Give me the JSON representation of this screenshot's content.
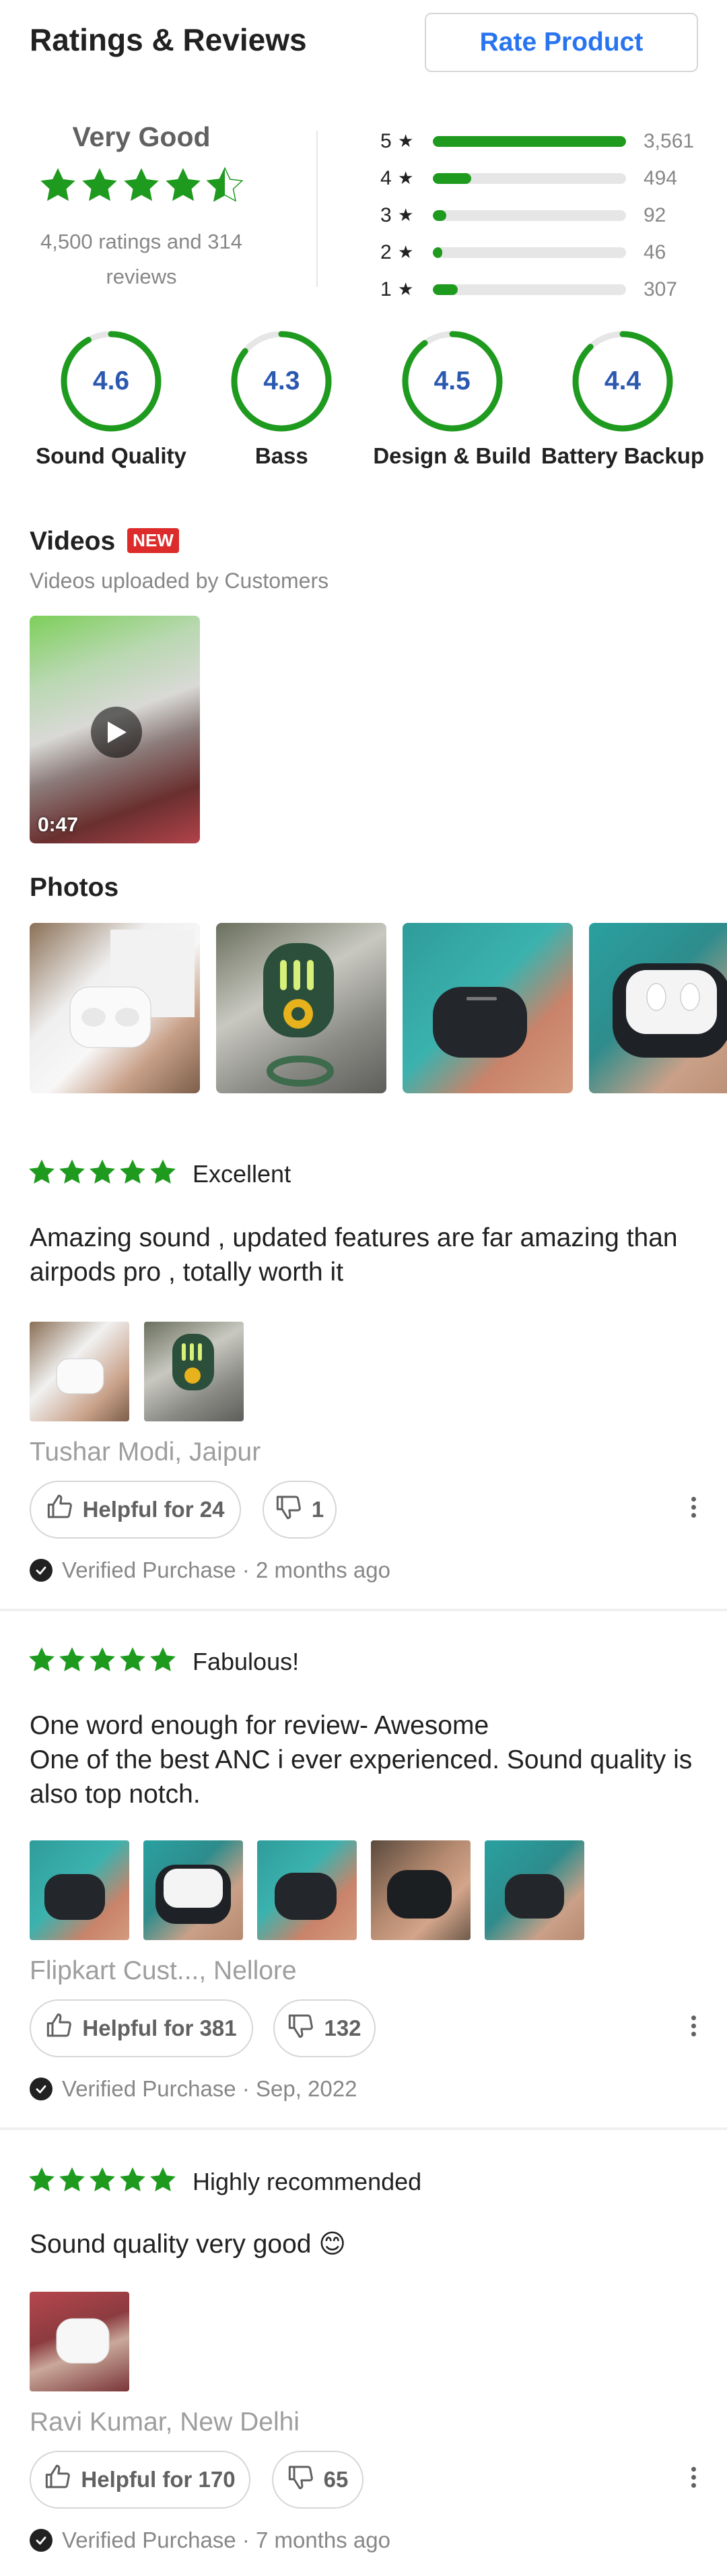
{
  "header": {
    "title": "Ratings & Reviews",
    "rate_button": "Rate Product"
  },
  "overall": {
    "label": "Very Good",
    "rating": 4.5,
    "counts_text": "4,500 ratings and 314 reviews",
    "star_color": "#1e9a1e"
  },
  "histogram": [
    {
      "stars": "5",
      "count": "3,561",
      "fraction": 1.0
    },
    {
      "stars": "4",
      "count": "494",
      "fraction": 0.2
    },
    {
      "stars": "3",
      "count": "92",
      "fraction": 0.07
    },
    {
      "stars": "2",
      "count": "46",
      "fraction": 0.05
    },
    {
      "stars": "1",
      "count": "307",
      "fraction": 0.13
    }
  ],
  "aspects": [
    {
      "label": "Sound Quality",
      "value": "4.6"
    },
    {
      "label": "Bass",
      "value": "4.3"
    },
    {
      "label": "Design & Build",
      "value": "4.5"
    },
    {
      "label": "Battery Backup",
      "value": "4.4"
    }
  ],
  "videos": {
    "title": "Videos",
    "badge": "NEW",
    "subtitle": "Videos uploaded by Customers",
    "items": [
      {
        "duration": "0:47",
        "icon": "play-icon"
      }
    ]
  },
  "photos": {
    "title": "Photos",
    "count": 4
  },
  "reviews": [
    {
      "stars": 5,
      "title": "Excellent",
      "text": "Amazing sound , updated features are far amazing than airpods pro , totally worth it",
      "photo_count": 2,
      "author": "Tushar Modi, Jaipur",
      "helpful": "Helpful for 24",
      "unhelpful": "1",
      "verified": "Verified Purchase · 2 months ago"
    },
    {
      "stars": 5,
      "title": "Fabulous!",
      "text": "One word enough for review- Awesome\nOne of the best ANC i ever experienced. Sound quality is also top notch.",
      "photo_count": 5,
      "author": "Flipkart Cust..., Nellore",
      "helpful": "Helpful for 381",
      "unhelpful": "132",
      "verified": "Verified Purchase · Sep, 2022"
    },
    {
      "stars": 5,
      "title": "Highly recommended",
      "text": "Sound quality very good 😊",
      "photo_count": 1,
      "author": "Ravi Kumar, New Delhi",
      "helpful": "Helpful for 170",
      "unhelpful": "65",
      "verified": "Verified Purchase · 7 months ago"
    }
  ],
  "colors": {
    "accent_blue": "#2874f0",
    "green": "#1e9a1e",
    "badge_red": "#dd2b2b",
    "gauge_text": "#2c59b0"
  }
}
